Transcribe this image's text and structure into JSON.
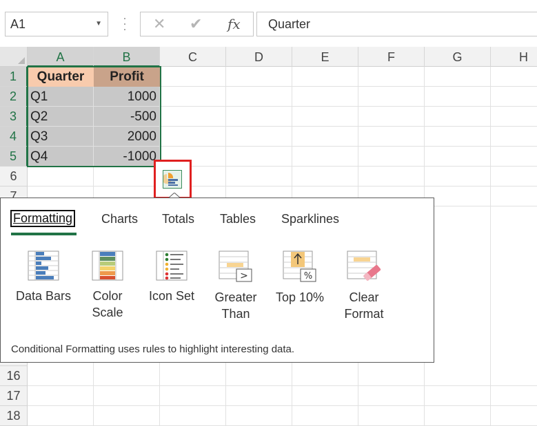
{
  "formula_bar": {
    "name_box": "A1",
    "cancel_glyph": "✕",
    "enter_glyph": "✔",
    "fx_glyph": "fx",
    "formula": "Quarter"
  },
  "columns": [
    "A",
    "B",
    "C",
    "D",
    "E",
    "F",
    "G",
    "H"
  ],
  "rows": [
    "1",
    "2",
    "3",
    "4",
    "5",
    "6",
    "7",
    "16",
    "17",
    "18"
  ],
  "cells": {
    "A1": "Quarter",
    "B1": "Profit",
    "A2": "Q1",
    "B2": "1000",
    "A3": "Q2",
    "B3": "-500",
    "A4": "Q3",
    "B4": "2000",
    "A5": "Q4",
    "B5": "-1000"
  },
  "colors": {
    "header_a": "#f8cbad",
    "header_b": "#c9a38a",
    "selection": "#217346",
    "highlight_box": "#e02020"
  },
  "quick_analysis": {
    "icon": "quick-analysis-icon",
    "tabs": [
      {
        "label": "Formatting",
        "hotkey": "F"
      },
      {
        "label": "Charts",
        "hotkey": "C"
      },
      {
        "label": "Totals",
        "hotkey": "o"
      },
      {
        "label": "Tables",
        "hotkey": "T"
      },
      {
        "label": "Sparklines",
        "hotkey": "S"
      }
    ],
    "options": [
      {
        "line1": "Data Bars",
        "line2": "",
        "icon": "data-bars-icon"
      },
      {
        "line1": "Color",
        "line2": "Scale",
        "icon": "color-scale-icon"
      },
      {
        "line1": "Icon Set",
        "line2": "",
        "icon": "icon-set-icon"
      },
      {
        "line1": "Greater",
        "line2": "Than",
        "icon": "greater-than-icon"
      },
      {
        "line1": "Top 10%",
        "line2": "",
        "icon": "top-10-percent-icon"
      },
      {
        "line1": "Clear",
        "line2": "Format",
        "icon": "clear-format-icon"
      }
    ],
    "description": "Conditional Formatting uses rules to highlight interesting data."
  }
}
